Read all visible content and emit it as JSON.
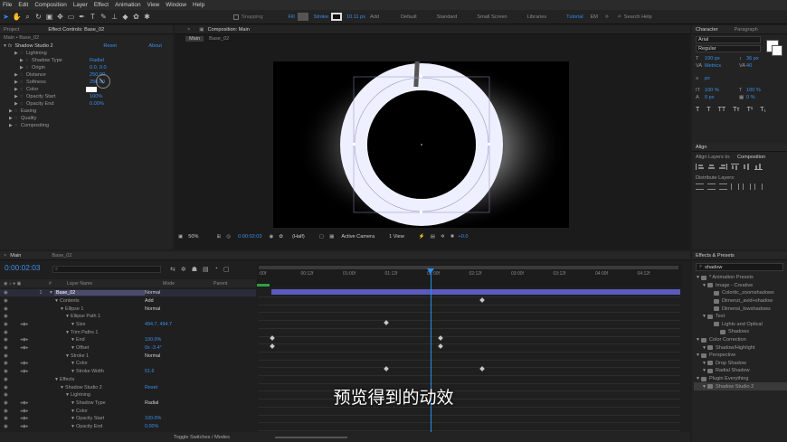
{
  "menu": [
    "File",
    "Edit",
    "Composition",
    "Layer",
    "Effect",
    "Animation",
    "View",
    "Window",
    "Help"
  ],
  "toolbar": {
    "snapping": "Snapping",
    "fill": "Fill",
    "stroke": "Stroke",
    "stroke_px": "10.11 px",
    "add": "Add",
    "workspaces": [
      "Default",
      "Standard",
      "Small Screen",
      "Libraries"
    ],
    "active_workspace": "Tutorial",
    "extra_workspace": "EM",
    "search_placeholder": "Search Help"
  },
  "left_panel": {
    "tabs": [
      "Project",
      "Effect Controls: Base_02"
    ],
    "breadcrumb": "Main • Base_02",
    "effect_name": "Shadow Studio 2",
    "reset": "Reset",
    "about": "About",
    "props": [
      {
        "name": "Lightning",
        "value": "",
        "indent": 1
      },
      {
        "name": "Shadow Type",
        "value": "Radial",
        "indent": 2
      },
      {
        "name": "Origin",
        "value": "0.0, 0.0",
        "indent": 2
      },
      {
        "name": "Distance",
        "value": "250.00",
        "indent": 1
      },
      {
        "name": "Softness",
        "value": "250.00",
        "indent": 1
      },
      {
        "name": "Color",
        "value": "",
        "indent": 1
      },
      {
        "name": "Opacity Start",
        "value": "100%",
        "indent": 1
      },
      {
        "name": "Opacity End",
        "value": "0.00%",
        "indent": 1
      },
      {
        "name": "Easing",
        "value": "",
        "indent": 0
      },
      {
        "name": "Quality",
        "value": "",
        "indent": 0
      },
      {
        "name": "Compositing",
        "value": "",
        "indent": 0
      }
    ]
  },
  "composition": {
    "tab": "Composition: Main",
    "sub_tabs": [
      "Main",
      "Base_02"
    ],
    "zoom": "50%",
    "timecode": "0:00:02:03",
    "resolution": "(Half)",
    "camera": "Active Camera",
    "view": "1 View",
    "exposure": "+0.0"
  },
  "right_panel": {
    "character_tabs": [
      "Character",
      "Paragraph"
    ],
    "font": "Arial",
    "style": "Regular",
    "size": "100 px",
    "leading": "36 px",
    "kerning": "Metrics",
    "tracking": "40",
    "stroke_width": "px",
    "vscale": "100 %",
    "hscale": "100 %",
    "baseline": "0 px",
    "tsume": "0 %",
    "align_title": "Align",
    "align_to_label": "Align Layers to:",
    "align_to": "Composition",
    "distribute": "Distribute Layers:"
  },
  "effects_presets": {
    "title": "Effects & Presets",
    "search": "shadow",
    "items": [
      {
        "label": "* Animation Presets",
        "indent": 0
      },
      {
        "label": "Image - Creative",
        "indent": 1
      },
      {
        "label": "Colortic_zoomshadows",
        "indent": 2
      },
      {
        "label": "Dimenzi_avid+shadow",
        "indent": 2
      },
      {
        "label": "Dimensi_lowshadows",
        "indent": 2
      },
      {
        "label": "Text",
        "indent": 1
      },
      {
        "label": "Lights and Optical",
        "indent": 2
      },
      {
        "label": "Shadows",
        "indent": 3
      },
      {
        "label": "Color Correction",
        "indent": 0
      },
      {
        "label": "Shadow/Highlight",
        "indent": 1
      },
      {
        "label": "Perspective",
        "indent": 0
      },
      {
        "label": "Drop Shadow",
        "indent": 1
      },
      {
        "label": "Radial Shadow",
        "indent": 1
      },
      {
        "label": "Plugin Everything",
        "indent": 0
      },
      {
        "label": "Shadow Studio 2",
        "indent": 1
      }
    ]
  },
  "timeline": {
    "tabs": [
      "Main",
      "Base_02"
    ],
    "timecode": "0:00:02:03",
    "col_layer": "Layer Name",
    "col_mode": "Mode",
    "col_parent": "Parent",
    "ruler": [
      ":00f",
      "00:12f",
      "01:00f",
      "01:12f",
      "02:00f",
      "02:12f",
      "03:00f",
      "03:12f",
      "04:00f",
      "04:12f"
    ],
    "rows": [
      {
        "label": "1",
        "name": "Base_02",
        "value": "Normal",
        "indent": 0,
        "value_color": "lt"
      },
      {
        "label": "",
        "name": "Contents",
        "value": "Add",
        "indent": 1,
        "value_color": "lt"
      },
      {
        "label": "",
        "name": "Ellipse 1",
        "value": "Normal",
        "indent": 2,
        "value_color": "lt"
      },
      {
        "label": "",
        "name": "Ellipse Path 1",
        "value": "",
        "indent": 3,
        "value_color": "blue"
      },
      {
        "label": "",
        "name": "Size",
        "value": "494.7, 494.7",
        "indent": 4,
        "value_color": "blue"
      },
      {
        "label": "",
        "name": "Trim Paths 1",
        "value": "",
        "indent": 3,
        "value_color": "blue"
      },
      {
        "label": "",
        "name": "End",
        "value": "100.0%",
        "indent": 4,
        "value_color": "blue"
      },
      {
        "label": "",
        "name": "Offset",
        "value": "0x -3.4°",
        "indent": 4,
        "value_color": "blue"
      },
      {
        "label": "",
        "name": "Stroke 1",
        "value": "Normal",
        "indent": 3,
        "value_color": "lt"
      },
      {
        "label": "",
        "name": "Color",
        "value": "",
        "indent": 4,
        "value_color": "blue"
      },
      {
        "label": "",
        "name": "Stroke Width",
        "value": "51.6",
        "indent": 4,
        "value_color": "blue"
      },
      {
        "label": "",
        "name": "Effects",
        "value": "",
        "indent": 1,
        "value_color": "lt"
      },
      {
        "label": "",
        "name": "Shadow Studio 2",
        "value": "Reset",
        "indent": 2,
        "value_color": "blue"
      },
      {
        "label": "",
        "name": "Lightning",
        "value": "",
        "indent": 3,
        "value_color": "lt"
      },
      {
        "label": "",
        "name": "Shadow Type",
        "value": "Radial",
        "indent": 4,
        "value_color": "lt"
      },
      {
        "label": "",
        "name": "Color",
        "value": "",
        "indent": 4,
        "value_color": "blue"
      },
      {
        "label": "",
        "name": "Opacity Start",
        "value": "100.0%",
        "indent": 4,
        "value_color": "blue"
      },
      {
        "label": "",
        "name": "Opacity End",
        "value": "0.00%",
        "indent": 4,
        "value_color": "blue"
      }
    ],
    "about": "About",
    "toggle": "Toggle Switches / Modes"
  },
  "subtitle": "预览得到的动效",
  "colors": {
    "accent": "#2d8ceb",
    "layer_bar": "#5a5abf",
    "ring": "#eef0ff"
  }
}
